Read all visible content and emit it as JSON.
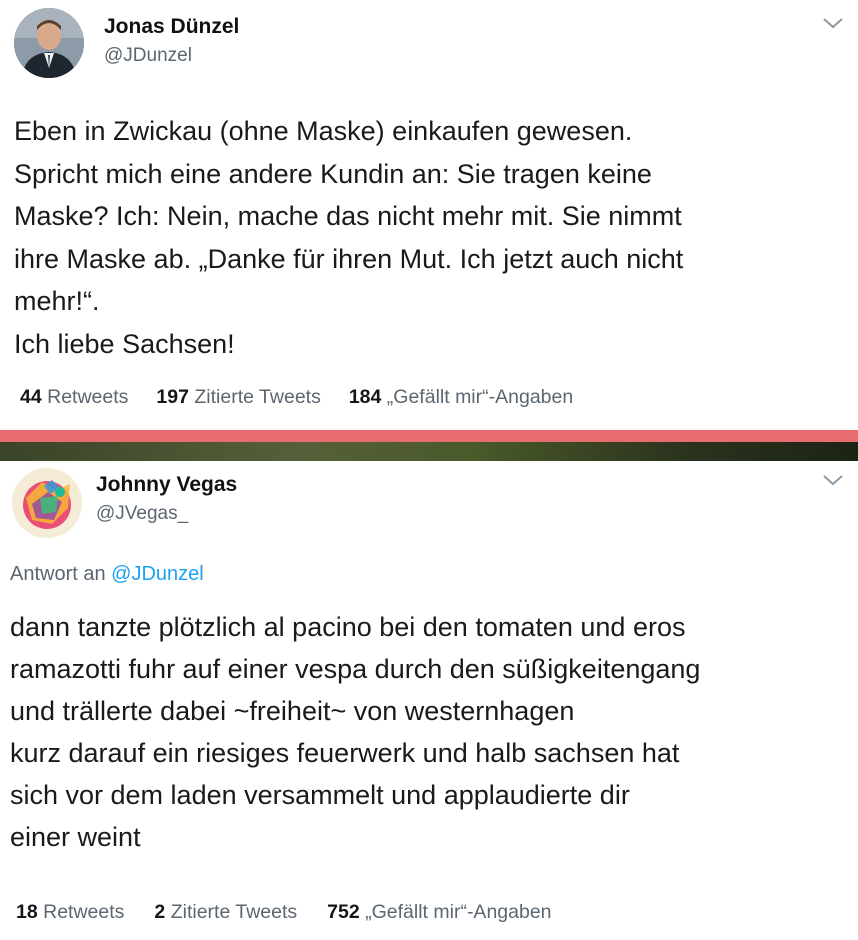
{
  "tweets": [
    {
      "author_name": "Jonas Dünzel",
      "author_handle": "@JDunzel",
      "text": "Eben in Zwickau (ohne Maske) einkaufen gewesen.\nSpricht mich eine andere Kundin an: Sie tragen keine\nMaske? Ich: Nein, mache das nicht mehr mit. Sie nimmt\nihre Maske ab. „Danke für ihren Mut. Ich jetzt auch nicht\nmehr!“.\nIch liebe Sachsen!",
      "stats": {
        "retweets_count": "44",
        "retweets_label": "Retweets",
        "quotes_count": "197",
        "quotes_label": "Zitierte Tweets",
        "likes_count": "184",
        "likes_label": "„Gefällt mir“-Angaben"
      }
    },
    {
      "author_name": "Johnny Vegas",
      "author_handle": "@JVegas_",
      "reply_prefix": "Antwort an",
      "reply_mention": "@JDunzel",
      "text": "dann tanzte plötzlich al pacino bei den tomaten und eros\nramazotti fuhr auf einer vespa durch den süßigkeitengang\nund trällerte dabei ~freiheit~ von westernhagen\nkurz darauf ein riesiges feuerwerk und halb sachsen hat\nsich vor dem laden versammelt und applaudierte dir\neiner weint",
      "stats": {
        "retweets_count": "18",
        "retweets_label": "Retweets",
        "quotes_count": "2",
        "quotes_label": "Zitierte Tweets",
        "likes_count": "752",
        "likes_label": "„Gefällt mir“-Angaben"
      }
    }
  ],
  "icons": {
    "menu": "chevron-down-icon"
  },
  "colors": {
    "link": "#1da1f2",
    "secondary_text": "#5b6670",
    "divider_accent": "#e86c70"
  }
}
